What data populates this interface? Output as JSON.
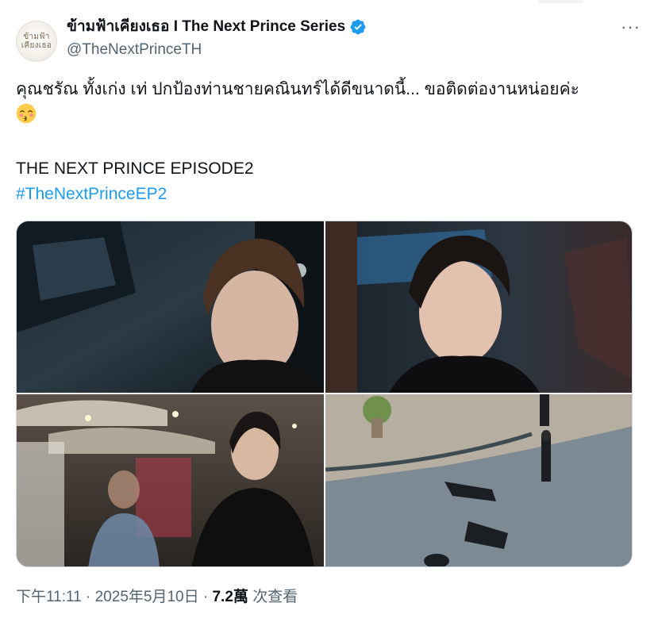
{
  "account": {
    "display_name": "ข้ามฟ้าเคียงเธอ I The Next Prince Series",
    "handle": "@TheNextPrinceTH",
    "avatar_text": "ข้ามฟ้า\nเคียงเธอ",
    "verified_icon": "verified-badge-icon",
    "more_icon": "more-options-icon",
    "more_glyph": "···"
  },
  "tweet": {
    "text": "คุณชรัณ ทั้งเก่ง เท่ ปกป้องท่านชายคณินทร์ได้ดีขนาดนี้... ขอติดต่องานหน่อยค่ะ",
    "emoji": "kissing-face-closed-eyes-emoji",
    "title_line": "THE NEXT PRINCE EPISODE2",
    "hashtag": "#TheNextPrinceEP2"
  },
  "media": {
    "photos": [
      {
        "name": "photo-young-man-in-car-back-seat"
      },
      {
        "name": "photo-man-in-car-looking-sideways"
      },
      {
        "name": "photo-man-at-night-market"
      },
      {
        "name": "photo-overhead-street-scene"
      }
    ]
  },
  "meta": {
    "time": "下午11:11",
    "separator": "·",
    "date": "2025年5月10日",
    "views_count": "7.2萬",
    "views_label": "次查看"
  },
  "colors": {
    "link": "#1d9bf0",
    "verified": "#1d9bf0",
    "secondary_text": "#536471",
    "primary_text": "#0f1419"
  }
}
